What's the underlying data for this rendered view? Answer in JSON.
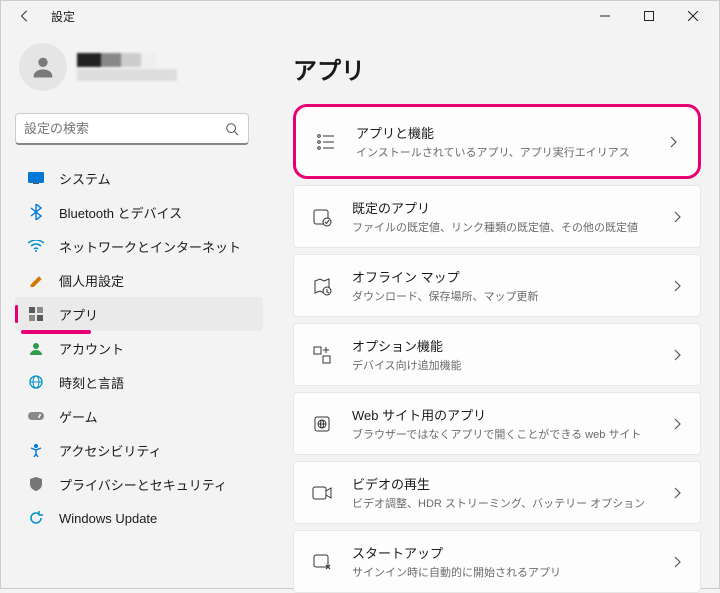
{
  "window": {
    "title": "設定"
  },
  "search": {
    "placeholder": "設定の検索"
  },
  "sidebar": {
    "items": [
      {
        "label": "システム"
      },
      {
        "label": "Bluetooth とデバイス"
      },
      {
        "label": "ネットワークとインターネット"
      },
      {
        "label": "個人用設定"
      },
      {
        "label": "アプリ"
      },
      {
        "label": "アカウント"
      },
      {
        "label": "時刻と言語"
      },
      {
        "label": "ゲーム"
      },
      {
        "label": "アクセシビリティ"
      },
      {
        "label": "プライバシーとセキュリティ"
      },
      {
        "label": "Windows Update"
      }
    ]
  },
  "page": {
    "title": "アプリ"
  },
  "cards": [
    {
      "title": "アプリと機能",
      "desc": "インストールされているアプリ、アプリ実行エイリアス"
    },
    {
      "title": "既定のアプリ",
      "desc": "ファイルの既定値、リンク種類の既定値、その他の既定値"
    },
    {
      "title": "オフライン マップ",
      "desc": "ダウンロード、保存場所、マップ更新"
    },
    {
      "title": "オプション機能",
      "desc": "デバイス向け追加機能"
    },
    {
      "title": "Web サイト用のアプリ",
      "desc": "ブラウザーではなくアプリで開くことができる web サイト"
    },
    {
      "title": "ビデオの再生",
      "desc": "ビデオ調整、HDR ストリーミング、バッテリー オプション"
    },
    {
      "title": "スタートアップ",
      "desc": "サインイン時に自動的に開始されるアプリ"
    }
  ]
}
